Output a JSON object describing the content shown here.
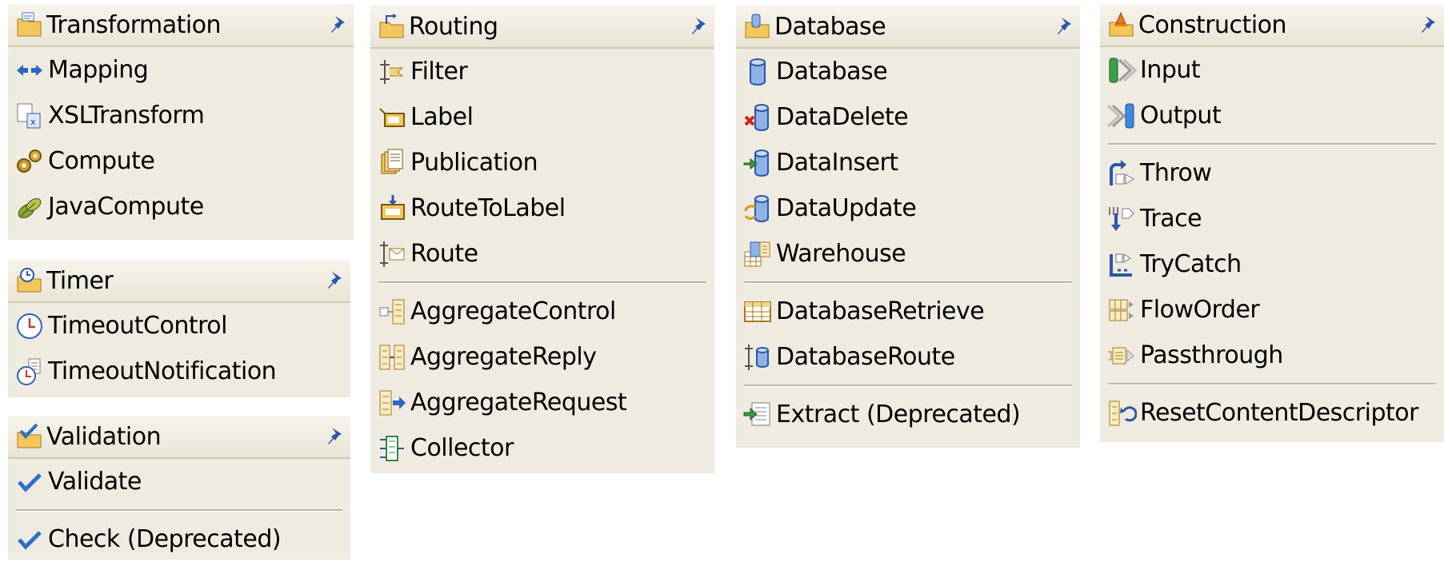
{
  "drawers": {
    "transformation": {
      "title": "Transformation",
      "items": [
        "Mapping",
        "XSLTransform",
        "Compute",
        "JavaCompute"
      ]
    },
    "timer": {
      "title": "Timer",
      "items": [
        "TimeoutControl",
        "TimeoutNotification"
      ]
    },
    "validation": {
      "title": "Validation",
      "items": [
        "Validate",
        "Check (Deprecated)"
      ]
    },
    "routing": {
      "title": "Routing",
      "items": [
        "Filter",
        "Label",
        "Publication",
        "RouteToLabel",
        "Route",
        "AggregateControl",
        "AggregateReply",
        "AggregateRequest",
        "Collector"
      ]
    },
    "database": {
      "title": "Database",
      "items": [
        "Database",
        "DataDelete",
        "DataInsert",
        "DataUpdate",
        "Warehouse",
        "DatabaseRetrieve",
        "DatabaseRoute",
        "Extract (Deprecated)"
      ]
    },
    "construction": {
      "title": "Construction",
      "items": [
        "Input",
        "Output",
        "Throw",
        "Trace",
        "TryCatch",
        "FlowOrder",
        "Passthrough",
        "ResetContentDescriptor"
      ]
    }
  },
  "colors": {
    "drawer_bg": "#efebe0",
    "header_border": "#cfc8b4",
    "separator": "#bdb6a2",
    "check_blue": "#2c6fc9"
  }
}
